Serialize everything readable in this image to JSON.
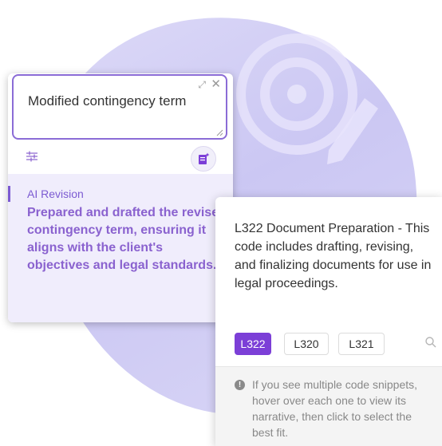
{
  "prompt": {
    "value": "Modified contingency term",
    "icons": {
      "expand": "expand-icon",
      "close": "close-icon",
      "settings": "sliders-icon",
      "ai": "ai-document-icon"
    }
  },
  "revision": {
    "label": "AI Revision",
    "text": "Prepared and drafted the revised contingency term, ensuring it aligns with the client's objectives and legal standards."
  },
  "code_card": {
    "description": "L322 Document Preparation - This code includes drafting, revising, and finalizing documents for use in legal proceedings.",
    "codes": [
      {
        "label": "L322",
        "selected": true
      },
      {
        "label": "L320",
        "selected": false
      },
      {
        "label": "L321",
        "selected": false
      }
    ],
    "help": "If you see multiple code snippets, hover over each one to view its narrative, then click to select the best fit."
  },
  "colors": {
    "accent": "#7c3fd7",
    "revision_text": "#8a62cf",
    "revision_bg": "#f0edfc",
    "blob": "#cbc7f3"
  }
}
